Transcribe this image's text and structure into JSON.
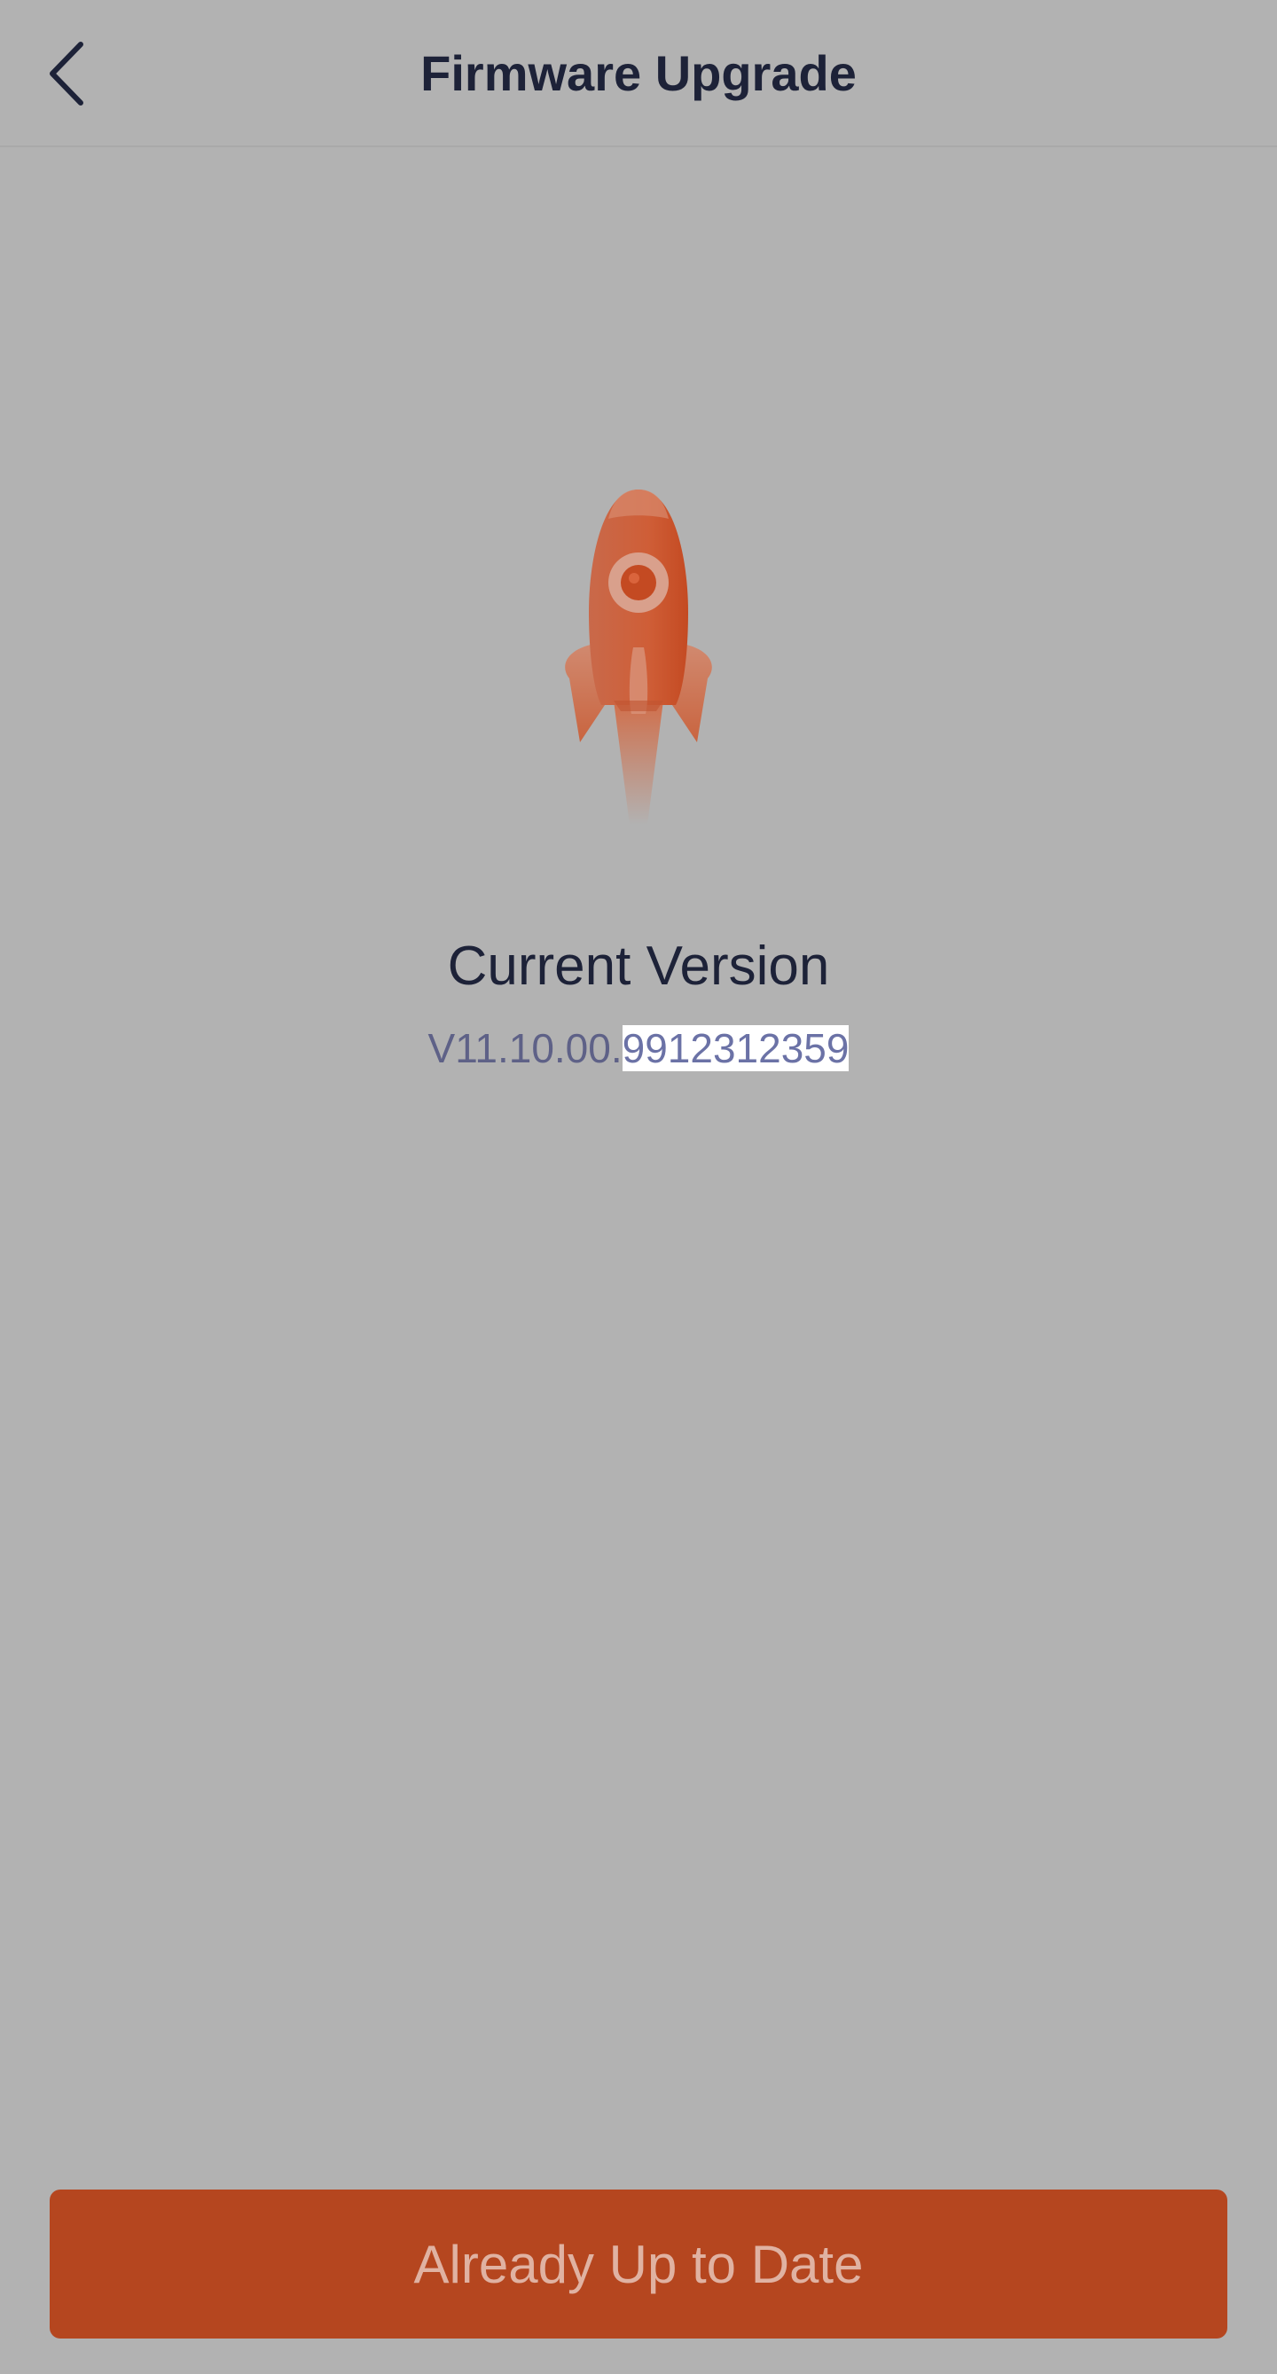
{
  "header": {
    "title": "Firmware Upgrade",
    "back_icon": "chevron-left-icon"
  },
  "hero": {
    "icon": "rocket-icon"
  },
  "version": {
    "label": "Current Version",
    "prefix": "V11.10.00.",
    "highlighted": "9912312359"
  },
  "action": {
    "button_label": "Already Up to Date"
  },
  "colors": {
    "background": "#b2b2b2",
    "accent": "#b5461f",
    "title_text": "#1d2238",
    "version_text": "#5e6187"
  }
}
